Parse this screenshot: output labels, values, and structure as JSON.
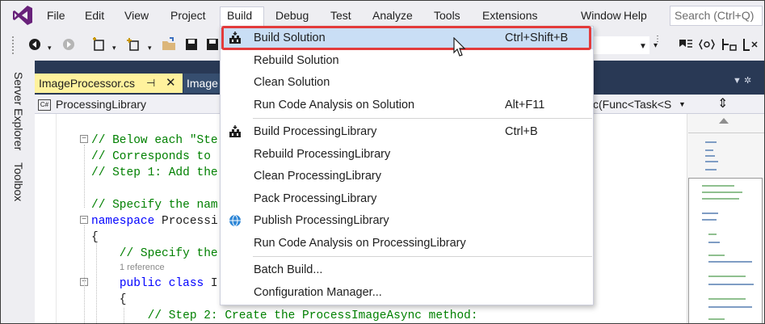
{
  "menubar": {
    "items": [
      "File",
      "Edit",
      "View",
      "Project",
      "Build",
      "Debug",
      "Test",
      "Analyze",
      "Tools",
      "Extensions",
      "Window",
      "Help"
    ],
    "search_placeholder": "Search (Ctrl+Q)"
  },
  "side_tabs": [
    "Server Explorer",
    "Toolbox"
  ],
  "tabs": {
    "active": "ImageProcessor.cs",
    "second": "Image"
  },
  "navbar": {
    "project": "ProcessingLibrary",
    "member": "c(Func<Task<S"
  },
  "code": {
    "lines": [
      "// Below each \"Ste",
      "// Corresponds to",
      "// Step 1: Add the",
      "",
      "// Specify the nam",
      "namespace Processi",
      "{",
      "    // Specify the",
      "    public class I",
      "    {",
      "        // Step 2: Create the ProcessImageAsync method:"
    ],
    "ref_hint": "1 reference"
  },
  "build_menu": {
    "items": [
      {
        "label": "Build Solution",
        "shortcut": "Ctrl+Shift+B",
        "icon": "build-icon"
      },
      {
        "label": "Rebuild Solution",
        "shortcut": ""
      },
      {
        "label": "Clean Solution",
        "shortcut": ""
      },
      {
        "label": "Run Code Analysis on Solution",
        "shortcut": "Alt+F11"
      },
      {
        "label": "Build ProcessingLibrary",
        "shortcut": "Ctrl+B",
        "icon": "build-icon"
      },
      {
        "label": "Rebuild ProcessingLibrary",
        "shortcut": ""
      },
      {
        "label": "Clean ProcessingLibrary",
        "shortcut": ""
      },
      {
        "label": "Pack ProcessingLibrary",
        "shortcut": ""
      },
      {
        "label": "Publish ProcessingLibrary",
        "shortcut": "",
        "icon": "globe-icon"
      },
      {
        "label": "Run Code Analysis on ProcessingLibrary",
        "shortcut": ""
      },
      {
        "label": "Batch Build...",
        "shortcut": ""
      },
      {
        "label": "Configuration Manager...",
        "shortcut": ""
      }
    ]
  },
  "colors": {
    "accent_purple": "#68217a",
    "highlight_border": "#e33b3b",
    "menu_highlight": "#c9def5",
    "tab_active": "#fff29d",
    "doc_background": "#293955"
  }
}
